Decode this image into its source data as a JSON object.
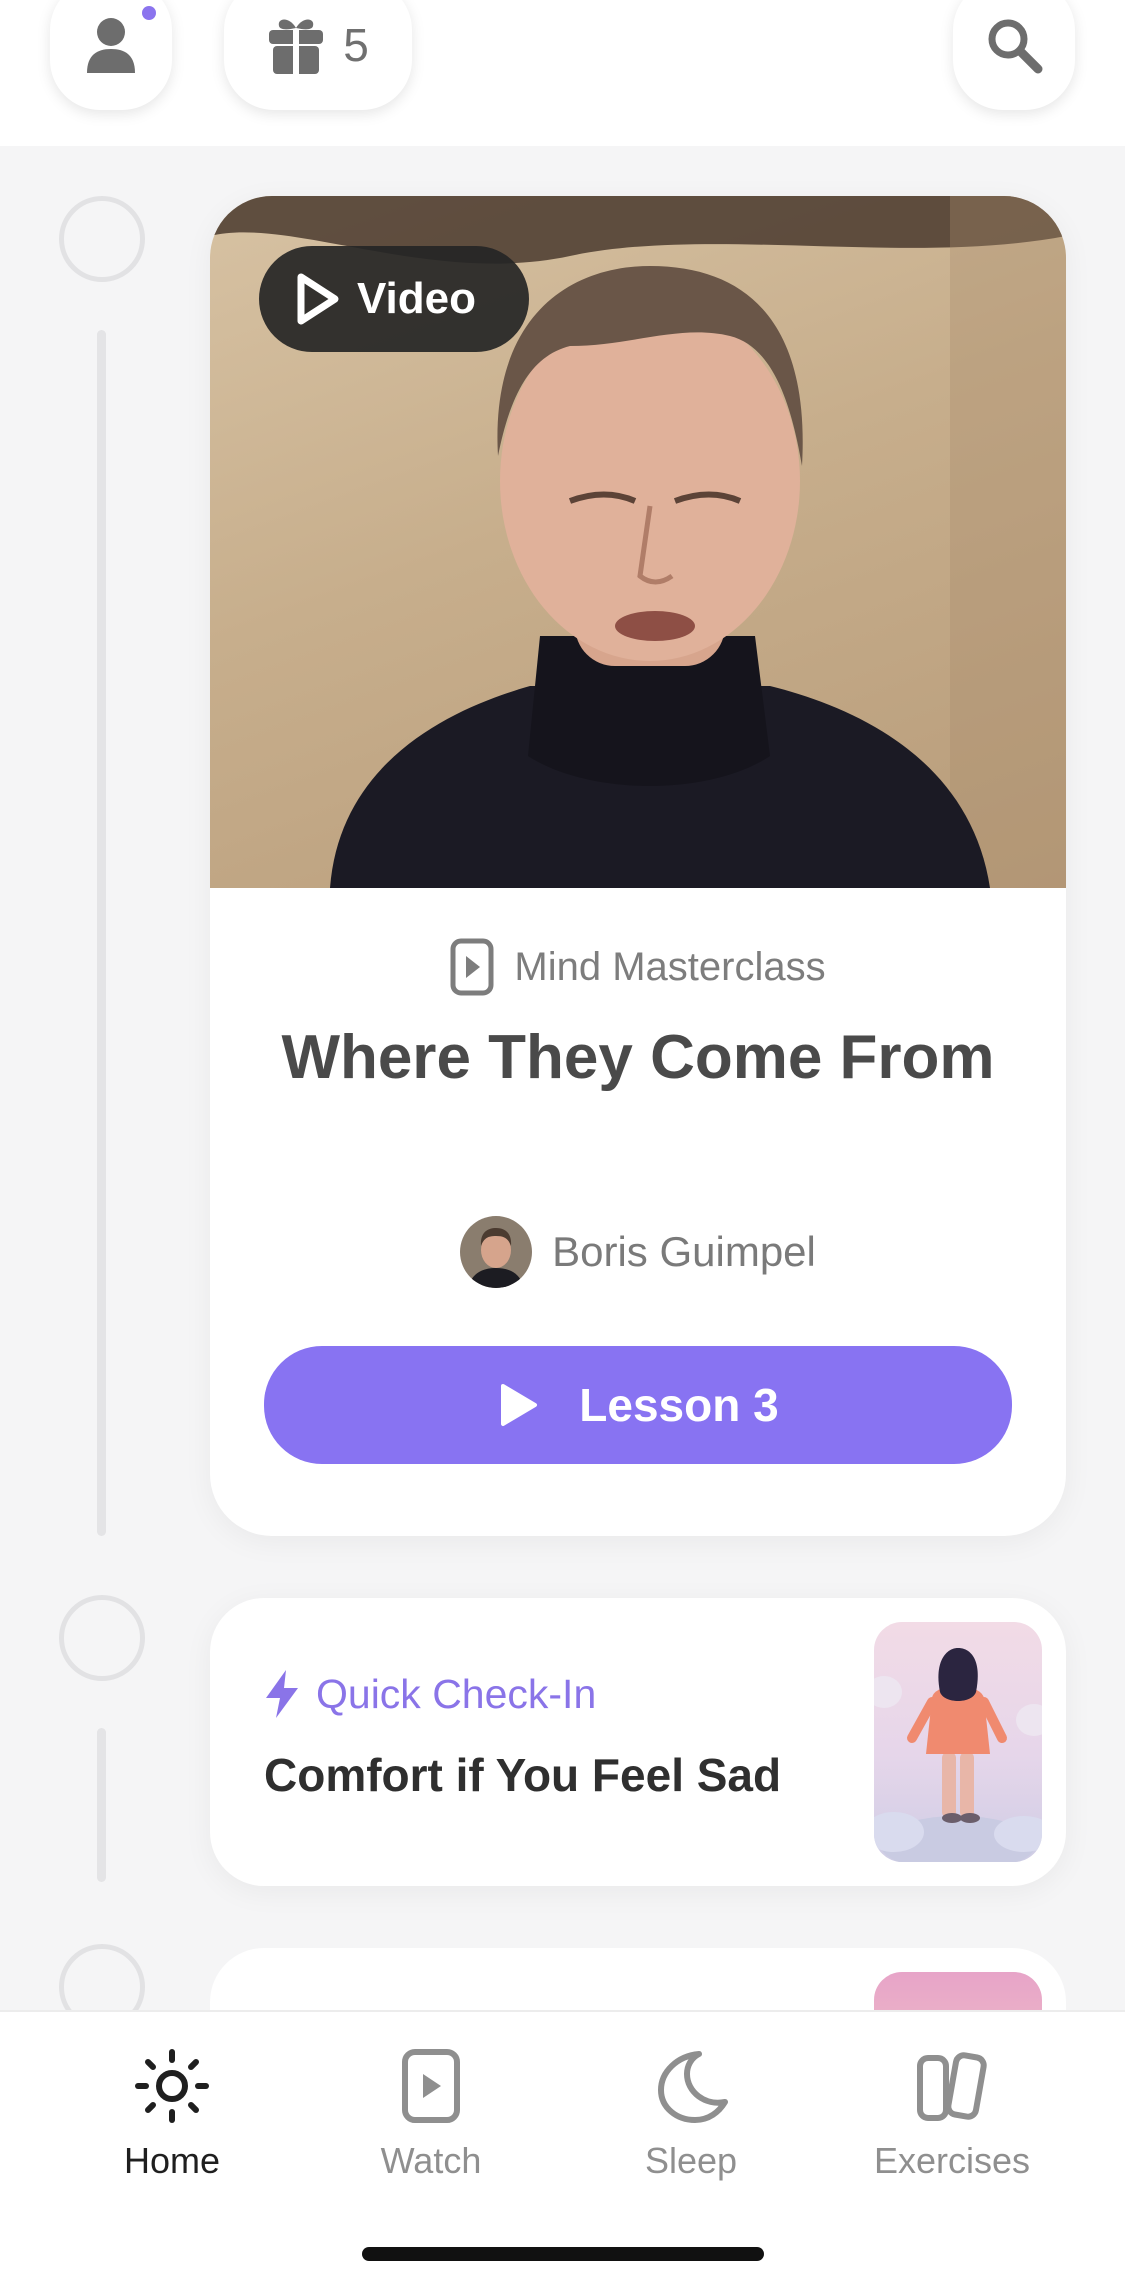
{
  "header": {
    "gift_count": "5",
    "has_notification": true
  },
  "main_card": {
    "badge_label": "Video",
    "category": "Mind Masterclass",
    "title": "Where They Come From",
    "author": "Boris Guimpel",
    "button_label": "Lesson 3"
  },
  "checkin_card": {
    "label": "Quick Check-In",
    "title": "Comfort if You Feel Sad"
  },
  "nav": {
    "items": [
      {
        "label": "Home",
        "icon": "sun-icon",
        "active": true
      },
      {
        "label": "Watch",
        "icon": "play-square-icon",
        "active": false
      },
      {
        "label": "Sleep",
        "icon": "moon-icon",
        "active": false
      },
      {
        "label": "Exercises",
        "icon": "cards-icon",
        "active": false
      }
    ]
  },
  "colors": {
    "accent": "#8873f2",
    "accent_text": "#8a74e8",
    "active_nav": "#1f1f1f",
    "inactive_nav": "#8f8f8f"
  }
}
